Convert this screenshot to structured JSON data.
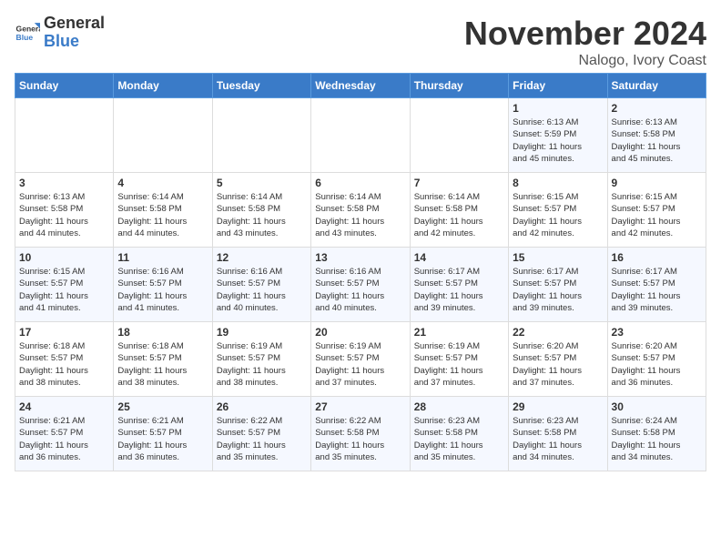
{
  "header": {
    "logo_line1": "General",
    "logo_line2": "Blue",
    "month": "November 2024",
    "location": "Nalogo, Ivory Coast"
  },
  "weekdays": [
    "Sunday",
    "Monday",
    "Tuesday",
    "Wednesday",
    "Thursday",
    "Friday",
    "Saturday"
  ],
  "weeks": [
    [
      {
        "day": "",
        "info": ""
      },
      {
        "day": "",
        "info": ""
      },
      {
        "day": "",
        "info": ""
      },
      {
        "day": "",
        "info": ""
      },
      {
        "day": "",
        "info": ""
      },
      {
        "day": "1",
        "info": "Sunrise: 6:13 AM\nSunset: 5:59 PM\nDaylight: 11 hours\nand 45 minutes."
      },
      {
        "day": "2",
        "info": "Sunrise: 6:13 AM\nSunset: 5:58 PM\nDaylight: 11 hours\nand 45 minutes."
      }
    ],
    [
      {
        "day": "3",
        "info": "Sunrise: 6:13 AM\nSunset: 5:58 PM\nDaylight: 11 hours\nand 44 minutes."
      },
      {
        "day": "4",
        "info": "Sunrise: 6:14 AM\nSunset: 5:58 PM\nDaylight: 11 hours\nand 44 minutes."
      },
      {
        "day": "5",
        "info": "Sunrise: 6:14 AM\nSunset: 5:58 PM\nDaylight: 11 hours\nand 43 minutes."
      },
      {
        "day": "6",
        "info": "Sunrise: 6:14 AM\nSunset: 5:58 PM\nDaylight: 11 hours\nand 43 minutes."
      },
      {
        "day": "7",
        "info": "Sunrise: 6:14 AM\nSunset: 5:58 PM\nDaylight: 11 hours\nand 42 minutes."
      },
      {
        "day": "8",
        "info": "Sunrise: 6:15 AM\nSunset: 5:57 PM\nDaylight: 11 hours\nand 42 minutes."
      },
      {
        "day": "9",
        "info": "Sunrise: 6:15 AM\nSunset: 5:57 PM\nDaylight: 11 hours\nand 42 minutes."
      }
    ],
    [
      {
        "day": "10",
        "info": "Sunrise: 6:15 AM\nSunset: 5:57 PM\nDaylight: 11 hours\nand 41 minutes."
      },
      {
        "day": "11",
        "info": "Sunrise: 6:16 AM\nSunset: 5:57 PM\nDaylight: 11 hours\nand 41 minutes."
      },
      {
        "day": "12",
        "info": "Sunrise: 6:16 AM\nSunset: 5:57 PM\nDaylight: 11 hours\nand 40 minutes."
      },
      {
        "day": "13",
        "info": "Sunrise: 6:16 AM\nSunset: 5:57 PM\nDaylight: 11 hours\nand 40 minutes."
      },
      {
        "day": "14",
        "info": "Sunrise: 6:17 AM\nSunset: 5:57 PM\nDaylight: 11 hours\nand 39 minutes."
      },
      {
        "day": "15",
        "info": "Sunrise: 6:17 AM\nSunset: 5:57 PM\nDaylight: 11 hours\nand 39 minutes."
      },
      {
        "day": "16",
        "info": "Sunrise: 6:17 AM\nSunset: 5:57 PM\nDaylight: 11 hours\nand 39 minutes."
      }
    ],
    [
      {
        "day": "17",
        "info": "Sunrise: 6:18 AM\nSunset: 5:57 PM\nDaylight: 11 hours\nand 38 minutes."
      },
      {
        "day": "18",
        "info": "Sunrise: 6:18 AM\nSunset: 5:57 PM\nDaylight: 11 hours\nand 38 minutes."
      },
      {
        "day": "19",
        "info": "Sunrise: 6:19 AM\nSunset: 5:57 PM\nDaylight: 11 hours\nand 38 minutes."
      },
      {
        "day": "20",
        "info": "Sunrise: 6:19 AM\nSunset: 5:57 PM\nDaylight: 11 hours\nand 37 minutes."
      },
      {
        "day": "21",
        "info": "Sunrise: 6:19 AM\nSunset: 5:57 PM\nDaylight: 11 hours\nand 37 minutes."
      },
      {
        "day": "22",
        "info": "Sunrise: 6:20 AM\nSunset: 5:57 PM\nDaylight: 11 hours\nand 37 minutes."
      },
      {
        "day": "23",
        "info": "Sunrise: 6:20 AM\nSunset: 5:57 PM\nDaylight: 11 hours\nand 36 minutes."
      }
    ],
    [
      {
        "day": "24",
        "info": "Sunrise: 6:21 AM\nSunset: 5:57 PM\nDaylight: 11 hours\nand 36 minutes."
      },
      {
        "day": "25",
        "info": "Sunrise: 6:21 AM\nSunset: 5:57 PM\nDaylight: 11 hours\nand 36 minutes."
      },
      {
        "day": "26",
        "info": "Sunrise: 6:22 AM\nSunset: 5:57 PM\nDaylight: 11 hours\nand 35 minutes."
      },
      {
        "day": "27",
        "info": "Sunrise: 6:22 AM\nSunset: 5:58 PM\nDaylight: 11 hours\nand 35 minutes."
      },
      {
        "day": "28",
        "info": "Sunrise: 6:23 AM\nSunset: 5:58 PM\nDaylight: 11 hours\nand 35 minutes."
      },
      {
        "day": "29",
        "info": "Sunrise: 6:23 AM\nSunset: 5:58 PM\nDaylight: 11 hours\nand 34 minutes."
      },
      {
        "day": "30",
        "info": "Sunrise: 6:24 AM\nSunset: 5:58 PM\nDaylight: 11 hours\nand 34 minutes."
      }
    ]
  ]
}
